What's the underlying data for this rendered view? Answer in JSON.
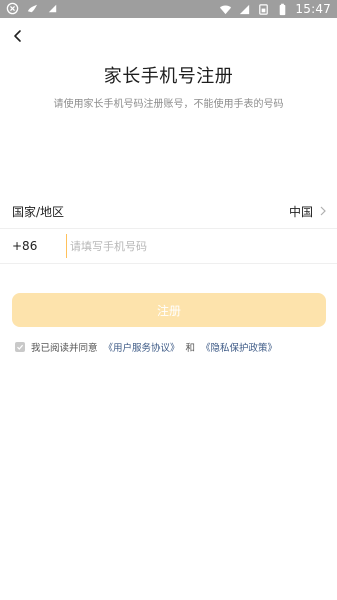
{
  "status_bar": {
    "time": "15:47",
    "left_icons": [
      "close-circle-icon",
      "bird-icon",
      "triangle-icon"
    ],
    "right_icons": [
      "wifi-icon",
      "signal-icon",
      "sim-icon",
      "battery-icon"
    ]
  },
  "header": {
    "back_icon": "chevron-left-icon",
    "title": "家长手机号注册",
    "subtitle": "请使用家长手机号码注册账号，不能使用手表的号码"
  },
  "form": {
    "region_label": "国家/地区",
    "region_value": "中国",
    "phone_code": "+86",
    "phone_value": "",
    "phone_placeholder": "请填写手机号码"
  },
  "register_button": {
    "label": "注册",
    "color": "#fde3ac",
    "label_color": "#ffffff"
  },
  "agreement": {
    "checked": true,
    "prefix": "我已阅读并同意",
    "user_agreement": "《用户服务协议》",
    "and": "和",
    "privacy_policy": "《隐私保护政策》"
  }
}
